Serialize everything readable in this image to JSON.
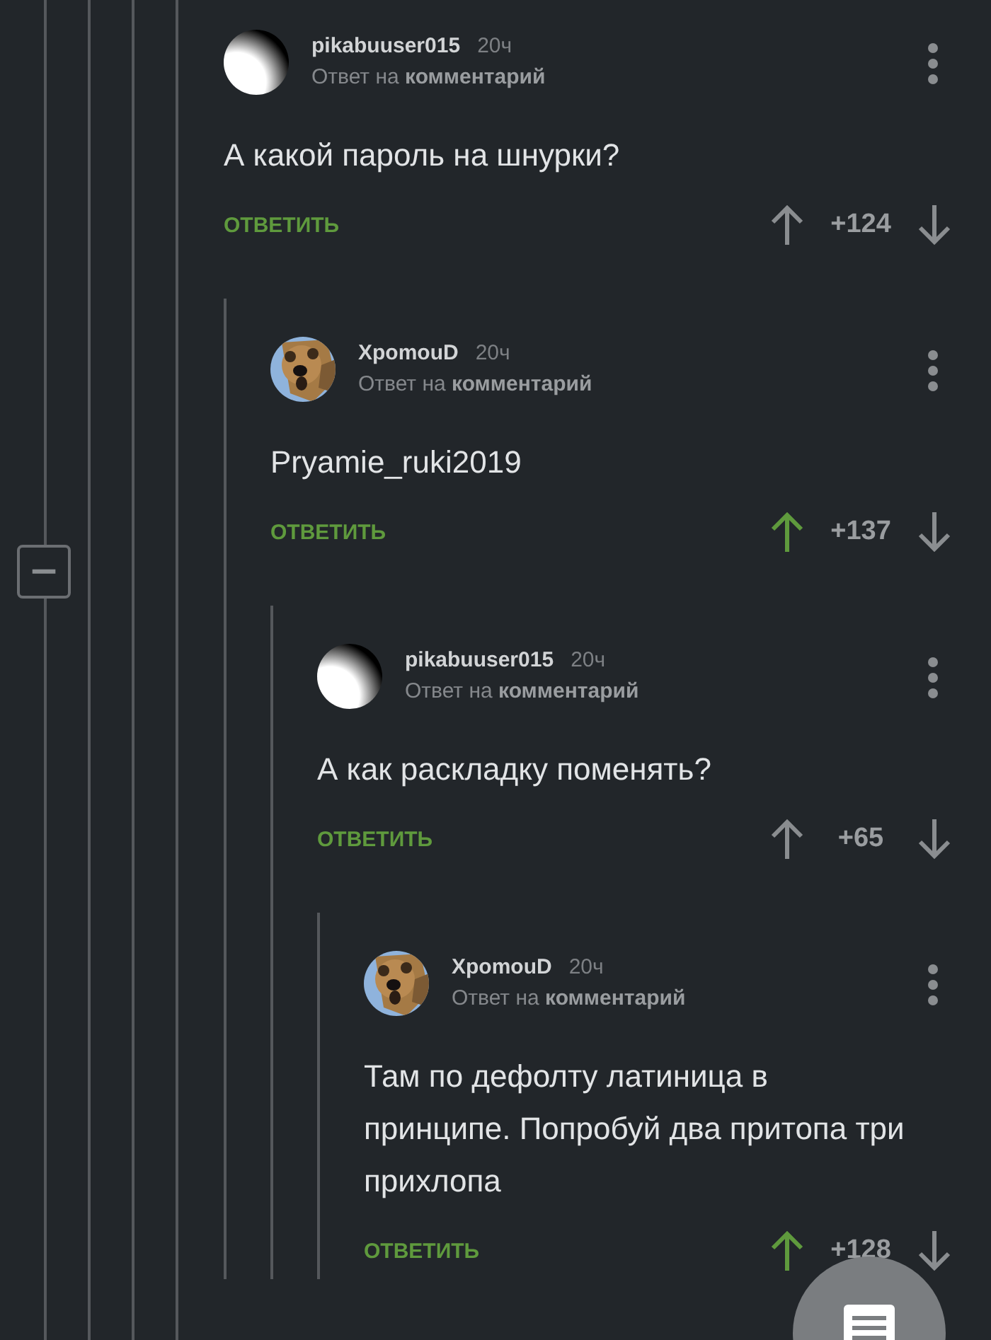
{
  "collapse_button": {
    "label": "−"
  },
  "comments": [
    {
      "author": "pikabuuser015",
      "time": "20ч",
      "reply_to": "Ответ на **комментарий**",
      "avatar": {
        "kind": "default"
      },
      "text": "А какой пароль на шнурки?",
      "reply": "ОТВЕТИТЬ",
      "score": "+124",
      "upvoted": false,
      "children": [
        {
          "author": "XpomouD",
          "time": "20ч",
          "reply_to": "Ответ на **комментарий**",
          "text": "Pryamie_ruki2019",
          "reply": "ОТВЕТИТЬ",
          "score": "+137",
          "upvoted": true,
          "children": [
            {
              "author": "pikabuuser015",
              "time": "20ч",
              "reply_to": "Ответ на **комментарий**",
              "avatar": {
                "kind": "default"
              },
              "text": "А как раскладку поменять?",
              "reply": "ОТВЕТИТЬ",
              "score": "+65",
              "upvoted": false,
              "children": [
                {
                  "author": "XpomouD",
                  "time": "20ч",
                  "reply_to": "Ответ на **комментарий**",
                  "text": "Там по дефолту латиница в принципе. Попробуй два притопа три прихлопа",
                  "reply": "ОТВЕТИТЬ",
                  "score": "+128",
                  "upvoted": true
                }
              ]
            }
          ]
        }
      ]
    }
  ]
}
